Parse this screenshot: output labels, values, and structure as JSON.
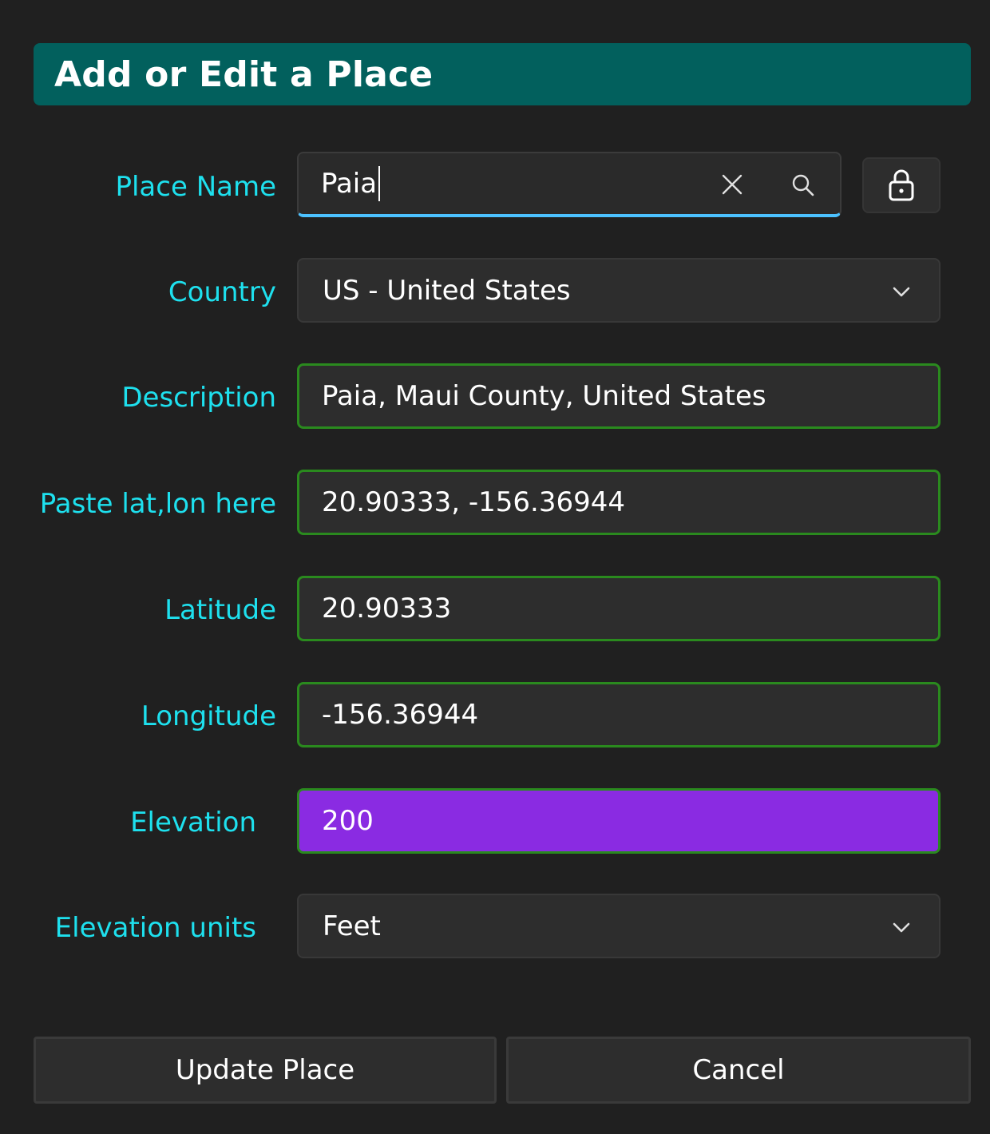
{
  "title": "Add or Edit a Place",
  "fields": {
    "place_name": {
      "label": "Place Name",
      "value": "Paia"
    },
    "country": {
      "label": "Country",
      "value": "US - United States"
    },
    "description": {
      "label": "Description",
      "value": "Paia, Maui County, United States"
    },
    "paste_latlon": {
      "label": "Paste lat,lon here",
      "value": "20.90333, -156.36944"
    },
    "latitude": {
      "label": "Latitude",
      "value": "20.90333"
    },
    "longitude": {
      "label": "Longitude",
      "value": "-156.36944"
    },
    "elevation": {
      "label": "Elevation",
      "value": "200"
    },
    "elevation_units": {
      "label": "Elevation units",
      "value": "Feet"
    }
  },
  "buttons": {
    "update": "Update Place",
    "cancel": "Cancel"
  },
  "icons": {
    "clear": "close-icon",
    "search": "search-icon",
    "lock": "lock-icon",
    "dropdown": "chevron-down-icon"
  },
  "colors": {
    "title_bg": "#02605d",
    "label": "#1ee0ee",
    "valid_border": "#2a8a1e",
    "focus_underline": "#4cc2ff",
    "elevation_bg": "#8a2be2"
  }
}
